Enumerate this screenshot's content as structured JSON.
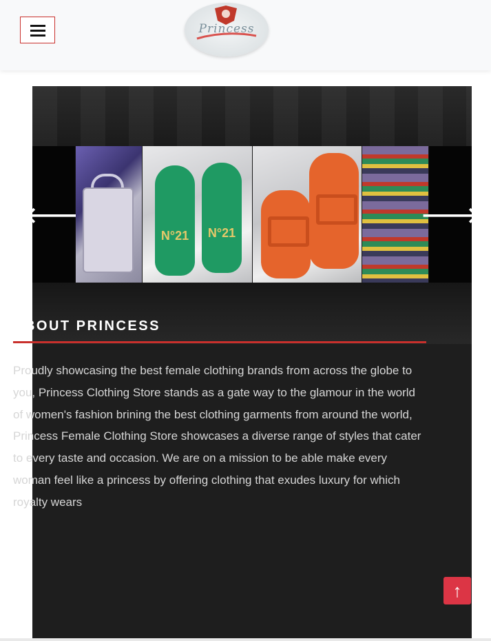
{
  "header": {
    "menu_icon": "hamburger-menu-icon",
    "logo_text": "Princess"
  },
  "slider": {
    "prev_icon": "arrow-left-icon",
    "next_icon": "arrow-right-icon",
    "prev_glyph": "🡐",
    "next_glyph": "🡒",
    "products": [
      {
        "name": "handbag"
      },
      {
        "name": "green-sandals",
        "strap_text": "N°21"
      },
      {
        "name": "orange-sandals"
      },
      {
        "name": "shoe-store-shelves"
      }
    ]
  },
  "about": {
    "title": "ABOUT PRINCESS",
    "text": "Proudly showcasing the best female clothing brands from across the globe to you, Princess Clothing Store stands as a gate way to the glamour in the world of women's fashion brining the best clothing garments from around the world, Princess Female Clothing Store showcases a diverse range of styles that cater to every taste and occasion. We are on a mission to be able make every woman feel like a princess by offering clothing that exudes luxury for which royalty wears"
  },
  "back_to_top": {
    "icon": "arrow-up-icon",
    "glyph": "↑"
  },
  "colors": {
    "accent": "#c9302c",
    "button_red": "#dc3545",
    "card_bg": "#1e1e1e"
  }
}
